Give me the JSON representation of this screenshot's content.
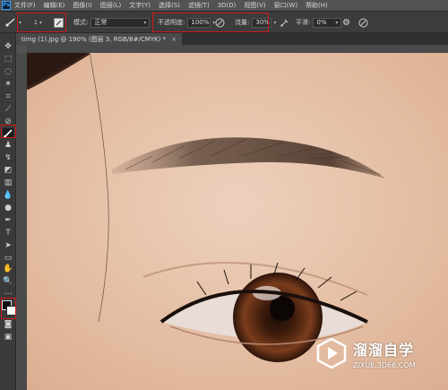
{
  "menu": [
    "文件(F)",
    "编辑(E)",
    "图像(I)",
    "图层(L)",
    "文字(Y)",
    "选择(S)",
    "滤镜(T)",
    "3D(D)",
    "视图(V)",
    "窗口(W)",
    "帮助(H)"
  ],
  "app_logo": "Ps",
  "options": {
    "brush_size": "1",
    "mode_label": "模式:",
    "mode_value": "正常",
    "opacity_label": "不透明度:",
    "opacity_value": "100%",
    "flow_label": "流量:",
    "flow_value": "30%",
    "smoothing_label": "平滑:",
    "smoothing_value": "0%"
  },
  "document_tab": "timg (1).jpg @ 190% (图层 3, RGB/8#/CMYK) *",
  "watermark": {
    "name": "溜溜自学",
    "url": "ZIXUE.3D66.COM"
  },
  "colors": {
    "highlight": "#d01818",
    "skin": "#e4bfa6",
    "accent": "#31a8ff"
  },
  "tools": [
    "move-tool",
    "marquee-tool",
    "lasso-tool",
    "magic-wand-tool",
    "crop-tool",
    "eyedropper-tool",
    "healing-tool",
    "brush-tool",
    "stamp-tool",
    "history-brush-tool",
    "eraser-tool",
    "gradient-tool",
    "blur-tool",
    "dodge-tool",
    "pen-tool",
    "type-tool",
    "path-select-tool",
    "shape-tool",
    "hand-tool",
    "zoom-tool",
    "more-tools",
    "color-swatches",
    "quick-mask",
    "screen-mode"
  ]
}
